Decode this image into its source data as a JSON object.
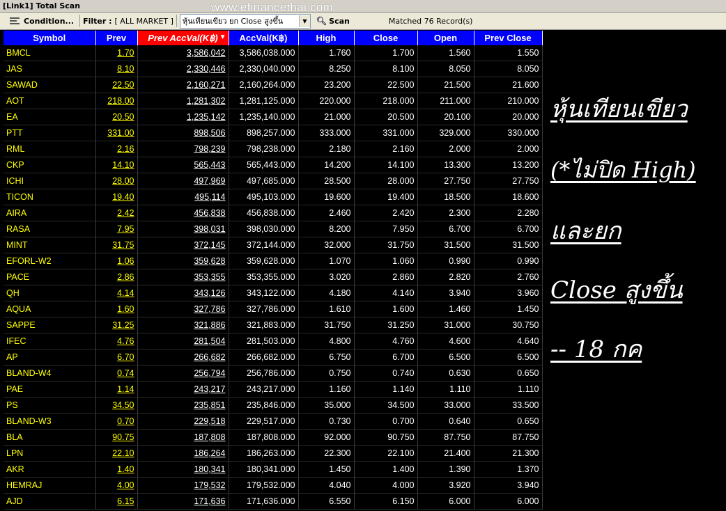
{
  "window": {
    "title": "[Link1] Total Scan"
  },
  "watermark": "www.efinancethai.com",
  "toolbar": {
    "condition_label": "Condition...",
    "filter_label": "Filter :",
    "filter_value": "[ ALL MARKET ]",
    "condition_select_value": "หุ้นเทียนเขียว  ยก  Close สูงขึ้น",
    "scan_label": "Scan",
    "matched_text": "Matched 76 Record(s)"
  },
  "columns": [
    "Symbol",
    "Prev",
    "Prev AccVal(K฿)",
    "AccVal(K฿)",
    "High",
    "Close",
    "Open",
    "Prev Close"
  ],
  "sorted_column": "Prev AccVal(K฿)",
  "rows": [
    [
      "BMCL",
      "1.70",
      "3,586,042",
      "3,586,038.000",
      "1.760",
      "1.700",
      "1.560",
      "1.550"
    ],
    [
      "JAS",
      "8.10",
      "2,330,446",
      "2,330,040.000",
      "8.250",
      "8.100",
      "8.050",
      "8.050"
    ],
    [
      "SAWAD",
      "22.50",
      "2,160,271",
      "2,160,264.000",
      "23.200",
      "22.500",
      "21.500",
      "21.600"
    ],
    [
      "AOT",
      "218.00",
      "1,281,302",
      "1,281,125.000",
      "220.000",
      "218.000",
      "211.000",
      "210.000"
    ],
    [
      "EA",
      "20.50",
      "1,235,142",
      "1,235,140.000",
      "21.000",
      "20.500",
      "20.100",
      "20.000"
    ],
    [
      "PTT",
      "331.00",
      "898,506",
      "898,257.000",
      "333.000",
      "331.000",
      "329.000",
      "330.000"
    ],
    [
      "RML",
      "2.16",
      "798,239",
      "798,238.000",
      "2.180",
      "2.160",
      "2.000",
      "2.000"
    ],
    [
      "CKP",
      "14.10",
      "565,443",
      "565,443.000",
      "14.200",
      "14.100",
      "13.300",
      "13.200"
    ],
    [
      "ICHI",
      "28.00",
      "497,969",
      "497,685.000",
      "28.500",
      "28.000",
      "27.750",
      "27.750"
    ],
    [
      "TICON",
      "19.40",
      "495,114",
      "495,103.000",
      "19.600",
      "19.400",
      "18.500",
      "18.600"
    ],
    [
      "AIRA",
      "2.42",
      "456,838",
      "456,838.000",
      "2.460",
      "2.420",
      "2.300",
      "2.280"
    ],
    [
      "RASA",
      "7.95",
      "398,031",
      "398,030.000",
      "8.200",
      "7.950",
      "6.700",
      "6.700"
    ],
    [
      "MINT",
      "31.75",
      "372,145",
      "372,144.000",
      "32.000",
      "31.750",
      "31.500",
      "31.500"
    ],
    [
      "EFORL-W2",
      "1.06",
      "359,628",
      "359,628.000",
      "1.070",
      "1.060",
      "0.990",
      "0.990"
    ],
    [
      "PACE",
      "2.86",
      "353,355",
      "353,355.000",
      "3.020",
      "2.860",
      "2.820",
      "2.760"
    ],
    [
      "QH",
      "4.14",
      "343,126",
      "343,122.000",
      "4.180",
      "4.140",
      "3.940",
      "3.960"
    ],
    [
      "AQUA",
      "1.60",
      "327,786",
      "327,786.000",
      "1.610",
      "1.600",
      "1.460",
      "1.450"
    ],
    [
      "SAPPE",
      "31.25",
      "321,886",
      "321,883.000",
      "31.750",
      "31.250",
      "31.000",
      "30.750"
    ],
    [
      "IFEC",
      "4.76",
      "281,504",
      "281,503.000",
      "4.800",
      "4.760",
      "4.600",
      "4.640"
    ],
    [
      "AP",
      "6.70",
      "266,682",
      "266,682.000",
      "6.750",
      "6.700",
      "6.500",
      "6.500"
    ],
    [
      "BLAND-W4",
      "0.74",
      "256,794",
      "256,786.000",
      "0.750",
      "0.740",
      "0.630",
      "0.650"
    ],
    [
      "PAE",
      "1.14",
      "243,217",
      "243,217.000",
      "1.160",
      "1.140",
      "1.110",
      "1.110"
    ],
    [
      "PS",
      "34.50",
      "235,851",
      "235,846.000",
      "35.000",
      "34.500",
      "33.000",
      "33.500"
    ],
    [
      "BLAND-W3",
      "0.70",
      "229,518",
      "229,517.000",
      "0.730",
      "0.700",
      "0.640",
      "0.650"
    ],
    [
      "BLA",
      "90.75",
      "187,808",
      "187,808.000",
      "92.000",
      "90.750",
      "87.750",
      "87.750"
    ],
    [
      "LPN",
      "22.10",
      "186,264",
      "186,263.000",
      "22.300",
      "22.100",
      "21.400",
      "21.300"
    ],
    [
      "AKR",
      "1.40",
      "180,341",
      "180,341.000",
      "1.450",
      "1.400",
      "1.390",
      "1.370"
    ],
    [
      "HEMRAJ",
      "4.00",
      "179,532",
      "179,532.000",
      "4.040",
      "4.000",
      "3.920",
      "3.940"
    ],
    [
      "AJD",
      "6.15",
      "171,636",
      "171,636.000",
      "6.550",
      "6.150",
      "6.000",
      "6.000"
    ]
  ],
  "annotation": {
    "line1": "หุ้นเทียนเขียว",
    "line2": "(*ไม่ปิด High)",
    "line3": " และยก",
    "line4": "Close สูงขึ้น",
    "line5": "-- 18 กค"
  },
  "colors": {
    "header_bg": "#0000ff",
    "sorted_header_bg": "#ff0000",
    "symbol_text": "#ffff00",
    "grid_bg": "#000000"
  }
}
